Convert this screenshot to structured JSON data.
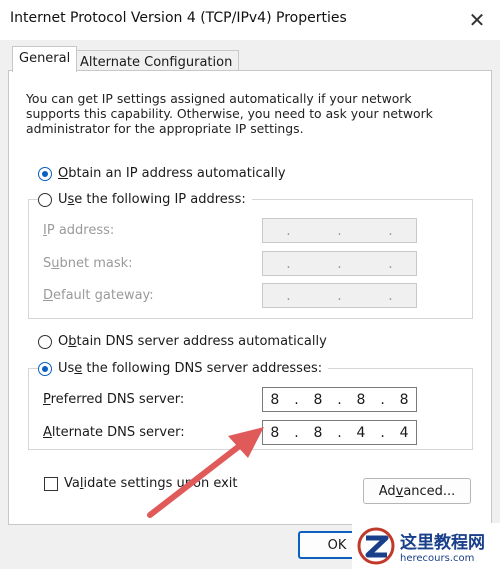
{
  "window": {
    "title": "Internet Protocol Version 4 (TCP/IPv4) Properties",
    "close_glyph": "✕"
  },
  "tabs": [
    {
      "label": "General",
      "active": true
    },
    {
      "label": "Alternate Configuration",
      "active": false
    }
  ],
  "description": "You can get IP settings assigned automatically if your network supports this capability. Otherwise, you need to ask your network administrator for the appropriate IP settings.",
  "ip_section": {
    "auto_label": "Obtain an IP address automatically",
    "auto_selected": true,
    "manual_label": "Use the following IP address:",
    "manual_selected": false,
    "fields": [
      {
        "label": "IP address:",
        "octets": [
          "",
          "",
          "",
          ""
        ]
      },
      {
        "label": "Subnet mask:",
        "octets": [
          "",
          "",
          "",
          ""
        ]
      },
      {
        "label": "Default gateway:",
        "octets": [
          "",
          "",
          "",
          ""
        ]
      }
    ]
  },
  "dns_section": {
    "auto_label": "Obtain DNS server address automatically",
    "auto_selected": false,
    "manual_label": "Use the following DNS server addresses:",
    "manual_selected": true,
    "preferred": {
      "label": "Preferred DNS server:",
      "octets": [
        "8",
        "8",
        "8",
        "8"
      ]
    },
    "alternate": {
      "label": "Alternate DNS server:",
      "octets": [
        "8",
        "8",
        "4",
        "4"
      ]
    }
  },
  "validate": {
    "label": "Validate settings upon exit",
    "checked": false
  },
  "buttons": {
    "advanced": "Advanced...",
    "ok": "OK"
  },
  "dot": ".",
  "watermark": {
    "cn": "这里教程网",
    "url": "herecours.com"
  },
  "colors": {
    "accent": "#0a5fbf",
    "arrow": "#e05a5a"
  }
}
